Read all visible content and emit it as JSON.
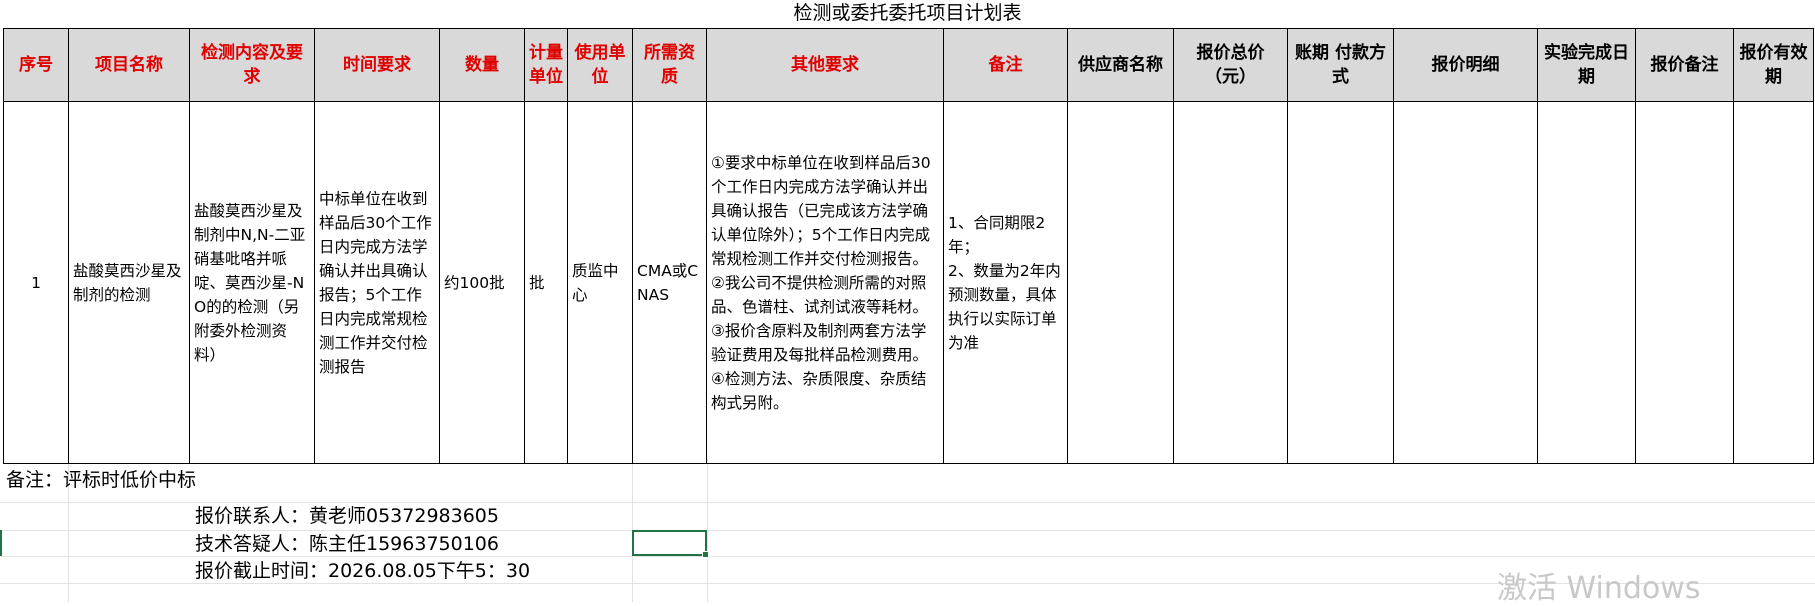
{
  "title": "检测或委托委托项目计划表",
  "headers": [
    {
      "label": "序号",
      "color": "red"
    },
    {
      "label": "项目名称",
      "color": "red"
    },
    {
      "label": "检测内容及要求",
      "color": "red"
    },
    {
      "label": "时间要求",
      "color": "red"
    },
    {
      "label": "数量",
      "color": "red"
    },
    {
      "label": "计量单位",
      "color": "red"
    },
    {
      "label": "使用单位",
      "color": "red"
    },
    {
      "label": "所需资质",
      "color": "red"
    },
    {
      "label": "其他要求",
      "color": "red"
    },
    {
      "label": "备注",
      "color": "red"
    },
    {
      "label": "供应商名称",
      "color": "black"
    },
    {
      "label": "报价总价（元）",
      "color": "black"
    },
    {
      "label": "账期 付款方式",
      "color": "black"
    },
    {
      "label": "报价明细",
      "color": "black"
    },
    {
      "label": "实验完成日期",
      "color": "black"
    },
    {
      "label": "报价备注",
      "color": "black"
    },
    {
      "label": "报价有效期",
      "color": "black"
    }
  ],
  "row": {
    "seq": "1",
    "project_name": "盐酸莫西沙星及制剂的检测",
    "content": "盐酸莫西沙星及制剂中N,N-二亚硝基吡咯并哌啶、莫西沙星-NO的的检测（另附委外检测资料）",
    "time_requirement": "中标单位在收到样品后30个工作日内完成方法学确认并出具确认报告；5个工作日内完成常规检测工作并交付检测报告",
    "quantity": "约100批",
    "unit": "批",
    "user_dept": "质监中心",
    "qualification": "CMA或CNAS",
    "other_requirements": [
      "①要求中标单位在收到样品后30个工作日内完成方法学确认并出具确认报告（已完成该方法学确认单位除外）；5个工作日内完成常规检测工作并交付检测报告。",
      "②我公司不提供检测所需的对照品、色谱柱、试剂试液等耗材。",
      "③报价含原料及制剂两套方法学验证费用及每批样品检测费用。",
      "④检测方法、杂质限度、杂质结构式另附。"
    ],
    "remarks": [
      "1、合同期限2年；",
      "2、数量为2年内预测数量，具体执行以实际订单为准"
    ],
    "supplier_name": "",
    "quote_total": "",
    "payment_terms": "",
    "quote_detail": "",
    "completion_date": "",
    "quote_remark": "",
    "quote_validity": ""
  },
  "note": "备注：评标时低价中标",
  "contacts": [
    "报价联系人：黄老师05372983605",
    "技术答疑人：陈主任15963750106",
    "报价截止时间：2026.08.05下午5：30"
  ],
  "watermark": "激活 Windows",
  "colors": {
    "header_bg": "#d9d9d9",
    "header_red": "#e00000",
    "selection": "#217346"
  }
}
